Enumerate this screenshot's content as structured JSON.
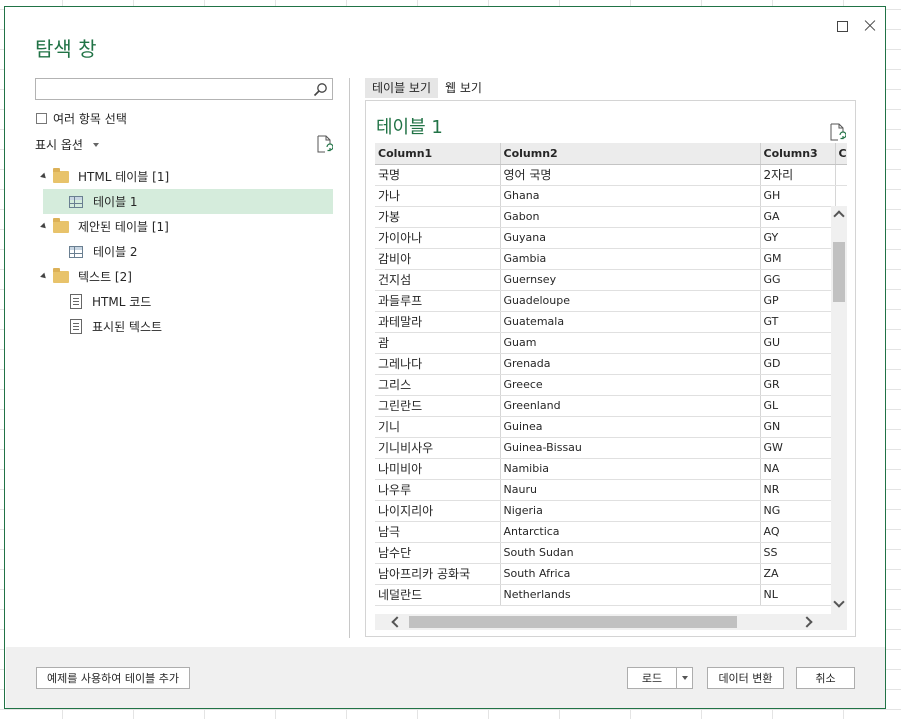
{
  "window": {
    "title": "탐색 창"
  },
  "left": {
    "search_value": "",
    "multi_select_label": "여러 항목 선택",
    "display_options_label": "표시 옵션",
    "tree": [
      {
        "label": "HTML 테이블 [1]",
        "type": "folder"
      },
      {
        "label": "테이블 1",
        "type": "table",
        "selected": true
      },
      {
        "label": "제안된 테이블 [1]",
        "type": "folder"
      },
      {
        "label": "테이블 2",
        "type": "table"
      },
      {
        "label": "텍스트 [2]",
        "type": "folder"
      },
      {
        "label": "HTML 코드",
        "type": "doc"
      },
      {
        "label": "표시된 텍스트",
        "type": "doc"
      }
    ]
  },
  "right": {
    "tabs": [
      {
        "label": "테이블 보기",
        "active": true
      },
      {
        "label": "웹 보기",
        "active": false
      }
    ],
    "preview_title": "테이블 1",
    "columns": [
      "Column1",
      "Column2",
      "Column3",
      "Co"
    ],
    "rows": [
      [
        "국명",
        "영어 국명",
        "2자리"
      ],
      [
        "가나",
        "Ghana",
        "GH"
      ],
      [
        "가봉",
        "Gabon",
        "GA"
      ],
      [
        "가이아나",
        "Guyana",
        "GY"
      ],
      [
        "감비아",
        "Gambia",
        "GM"
      ],
      [
        "건지섬",
        "Guernsey",
        "GG"
      ],
      [
        "과들루프",
        "Guadeloupe",
        "GP"
      ],
      [
        "과테말라",
        "Guatemala",
        "GT"
      ],
      [
        "괌",
        "Guam",
        "GU"
      ],
      [
        "그레나다",
        "Grenada",
        "GD"
      ],
      [
        "그리스",
        "Greece",
        "GR"
      ],
      [
        "그린란드",
        "Greenland",
        "GL"
      ],
      [
        "기니",
        "Guinea",
        "GN"
      ],
      [
        "기니비사우",
        "Guinea-Bissau",
        "GW"
      ],
      [
        "나미비아",
        "Namibia",
        "NA"
      ],
      [
        "나우루",
        "Nauru",
        "NR"
      ],
      [
        "나이지리아",
        "Nigeria",
        "NG"
      ],
      [
        "남극",
        "Antarctica",
        "AQ"
      ],
      [
        "남수단",
        "South Sudan",
        "SS"
      ],
      [
        "남아프리카 공화국",
        "South Africa",
        "ZA"
      ],
      [
        "네덜란드",
        "Netherlands",
        "NL"
      ]
    ]
  },
  "footer": {
    "add_table_label": "예제를 사용하여 테이블 추가",
    "load_label": "로드",
    "transform_label": "데이터 변환",
    "cancel_label": "취소"
  },
  "colors": {
    "accent": "#217346",
    "selected_bg": "#d5ecdc"
  }
}
